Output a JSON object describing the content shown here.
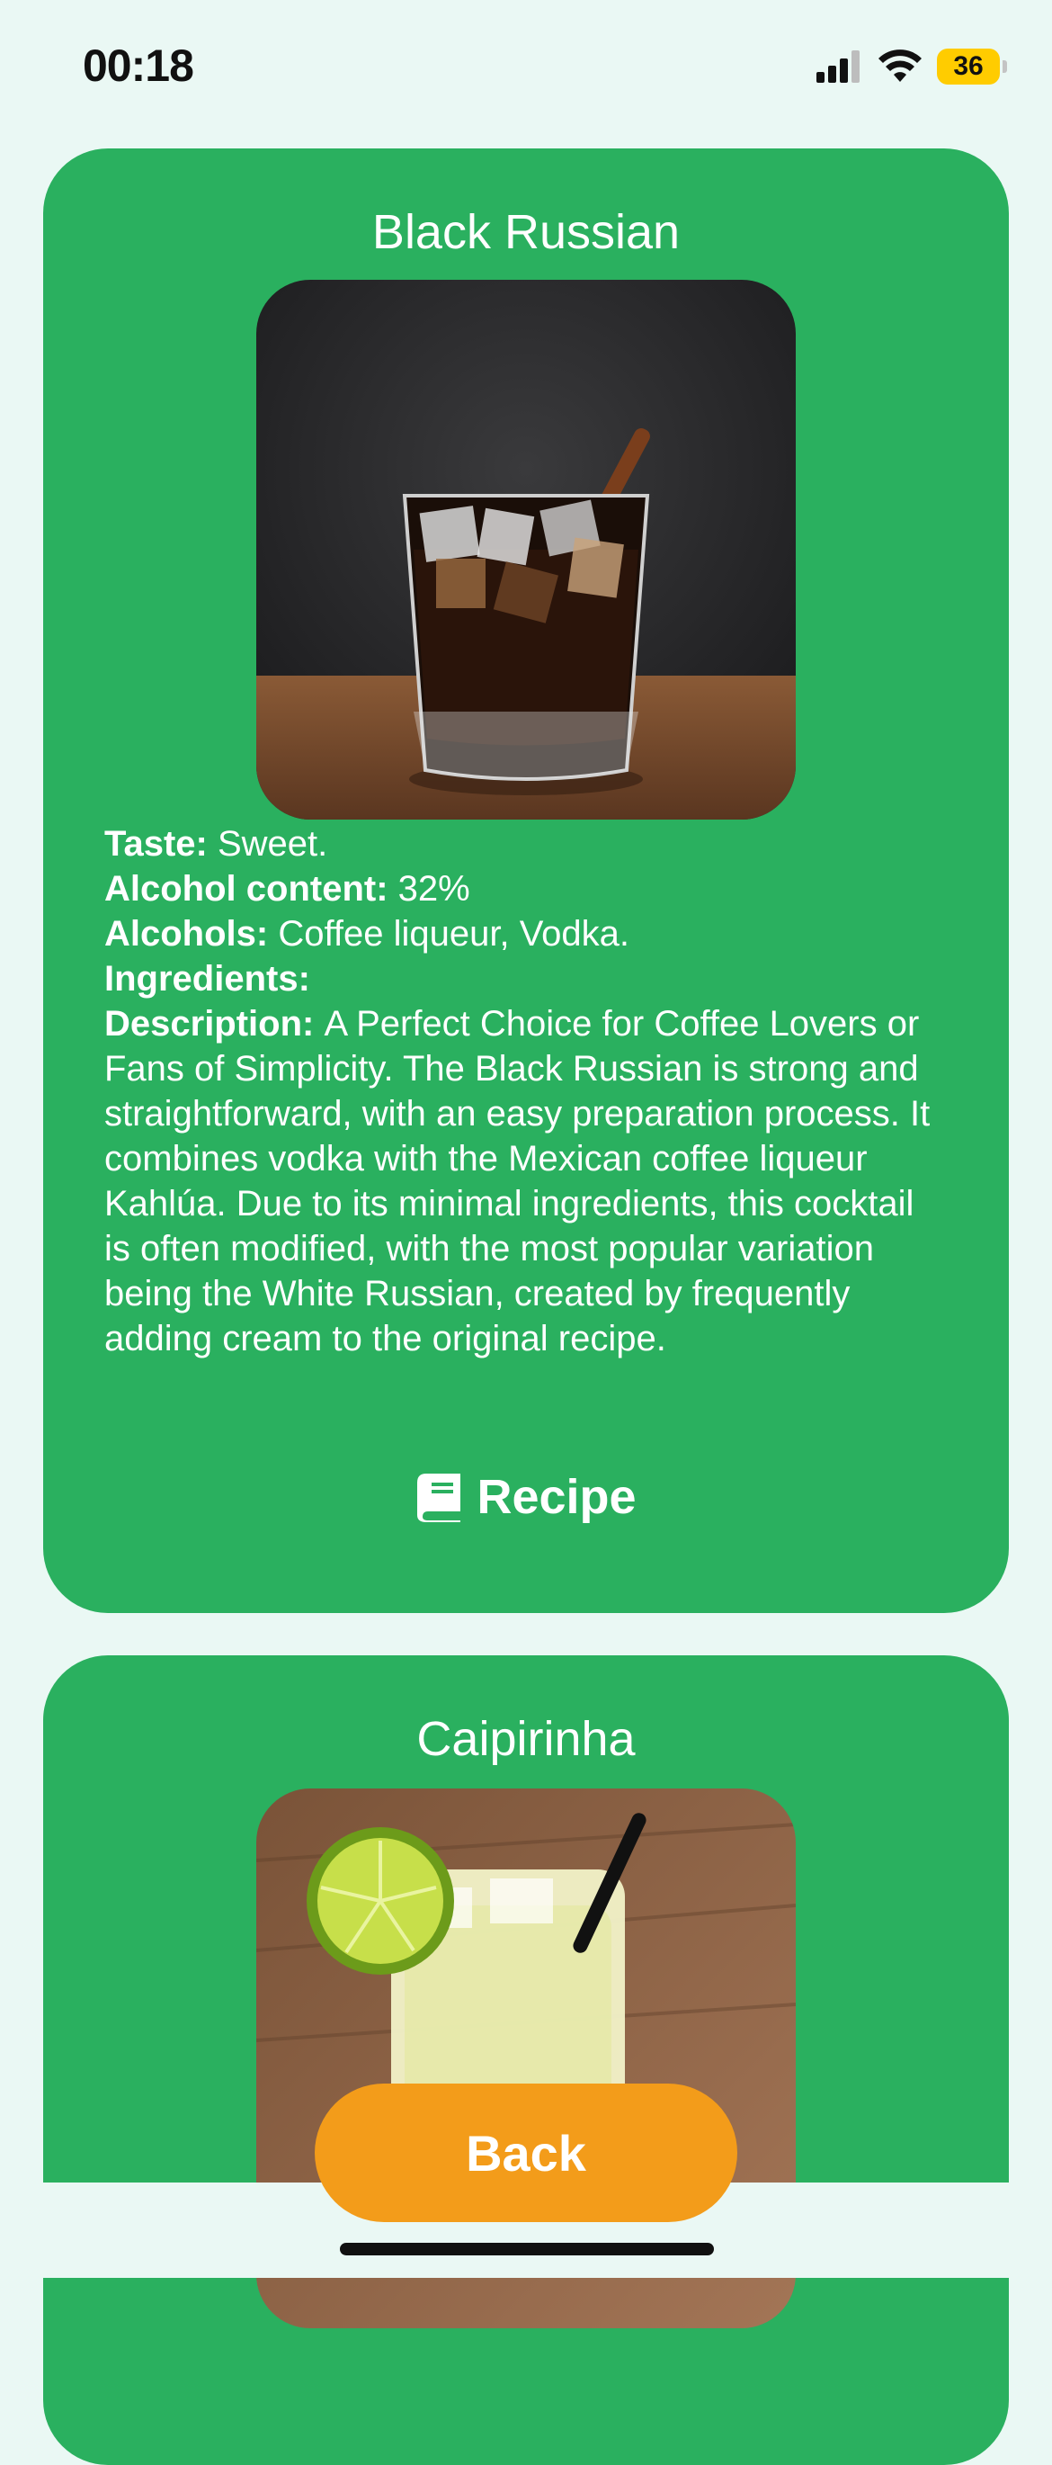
{
  "status": {
    "time": "00:18",
    "battery": "36"
  },
  "cards": [
    {
      "title": "Black Russian",
      "taste_label": "Taste:",
      "taste": "Sweet.",
      "alcohol_label": "Alcohol content:",
      "alcohol": "32%",
      "alcohols_label": "Alcohols:",
      "alcohols": "Coffee liqueur, Vodka.",
      "ingredients_label": "Ingredients:",
      "description_label": "Description:",
      "description": "A Perfect Choice for Coffee Lovers or Fans of Simplicity. The Black Russian is strong and straightforward, with an easy preparation process. It combines vodka with the Mexican coffee liqueur Kahlúa. Due to its minimal ingredients, this cocktail is often modified, with the most popular variation being the White Russian, created by frequently adding cream to the original recipe.",
      "recipe_label": "Recipe"
    },
    {
      "title": "Caipirinha"
    }
  ],
  "back_label": "Back",
  "colors": {
    "card": "#2ab05f",
    "back": "#f39c1a",
    "background": "#eaf8f4"
  }
}
